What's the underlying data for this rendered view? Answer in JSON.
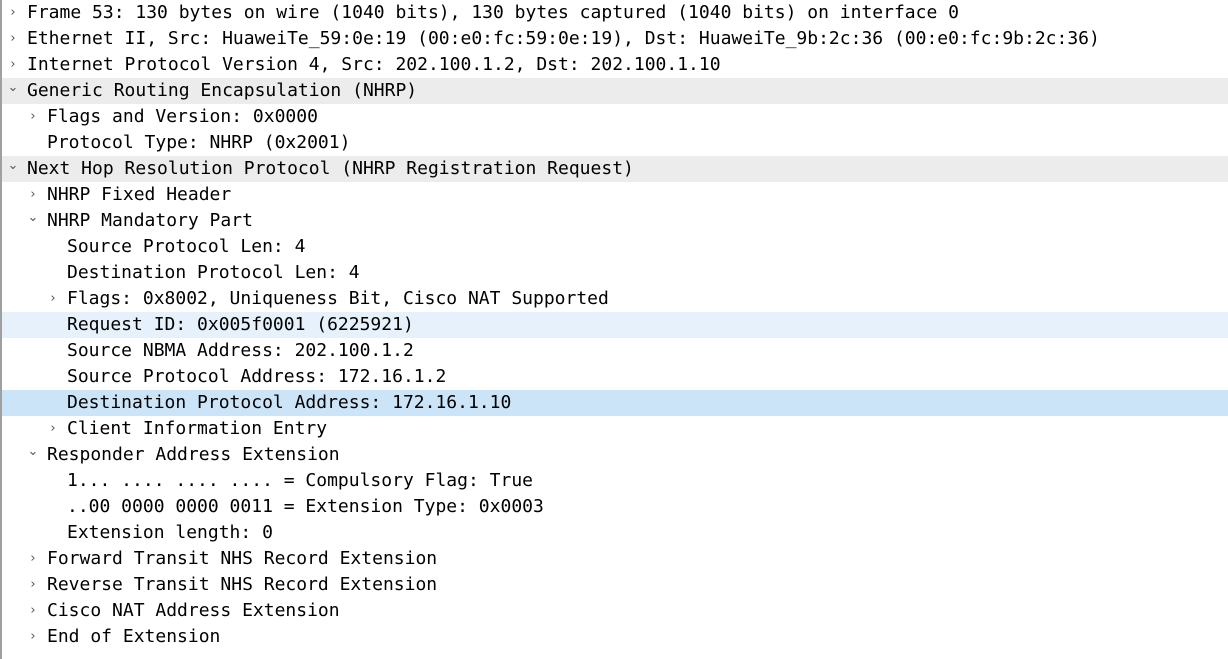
{
  "tree": {
    "rows": [
      {
        "text": "Frame 53: 130 bytes on wire (1040 bits), 130 bytes captured (1040 bits) on interface 0",
        "depth": 0,
        "expander": "collapsed",
        "state": "normal",
        "name": "frame"
      },
      {
        "text": "Ethernet II, Src: HuaweiTe_59:0e:19 (00:e0:fc:59:0e:19), Dst: HuaweiTe_9b:2c:36 (00:e0:fc:9b:2c:36)",
        "depth": 0,
        "expander": "collapsed",
        "state": "normal",
        "name": "ethernet"
      },
      {
        "text": "Internet Protocol Version 4, Src: 202.100.1.2, Dst: 202.100.1.10",
        "depth": 0,
        "expander": "collapsed",
        "state": "normal",
        "name": "ipv4"
      },
      {
        "text": "Generic Routing Encapsulation (NHRP)",
        "depth": 0,
        "expander": "expanded",
        "state": "gray",
        "name": "gre"
      },
      {
        "text": "Flags and Version: 0x0000",
        "depth": 1,
        "expander": "collapsed",
        "state": "normal",
        "name": "gre-flags-version"
      },
      {
        "text": "Protocol Type: NHRP (0x2001)",
        "depth": 1,
        "expander": "none",
        "state": "normal",
        "name": "gre-protocol-type"
      },
      {
        "text": "Next Hop Resolution Protocol (NHRP Registration Request)",
        "depth": 0,
        "expander": "expanded",
        "state": "gray",
        "name": "nhrp"
      },
      {
        "text": "NHRP Fixed Header",
        "depth": 1,
        "expander": "collapsed",
        "state": "normal",
        "name": "nhrp-fixed-header"
      },
      {
        "text": "NHRP Mandatory Part",
        "depth": 1,
        "expander": "expanded",
        "state": "normal",
        "name": "nhrp-mandatory-part"
      },
      {
        "text": "Source Protocol Len: 4",
        "depth": 2,
        "expander": "none",
        "state": "normal",
        "name": "source-protocol-len"
      },
      {
        "text": "Destination Protocol Len: 4",
        "depth": 2,
        "expander": "none",
        "state": "normal",
        "name": "destination-protocol-len"
      },
      {
        "text": "Flags: 0x8002, Uniqueness Bit, Cisco NAT Supported",
        "depth": 2,
        "expander": "collapsed",
        "state": "normal",
        "name": "nhrp-flags"
      },
      {
        "text": "Request ID: 0x005f0001 (6225921)",
        "depth": 2,
        "expander": "none",
        "state": "related",
        "name": "request-id"
      },
      {
        "text": "Source NBMA Address: 202.100.1.2",
        "depth": 2,
        "expander": "none",
        "state": "normal",
        "name": "source-nbma-address"
      },
      {
        "text": "Source Protocol Address: 172.16.1.2",
        "depth": 2,
        "expander": "none",
        "state": "normal",
        "name": "source-protocol-address"
      },
      {
        "text": "Destination Protocol Address: 172.16.1.10",
        "depth": 2,
        "expander": "none",
        "state": "selected",
        "name": "destination-protocol-address"
      },
      {
        "text": "Client Information Entry",
        "depth": 2,
        "expander": "collapsed",
        "state": "normal",
        "name": "client-information-entry"
      },
      {
        "text": "Responder Address Extension",
        "depth": 1,
        "expander": "expanded",
        "state": "normal",
        "name": "responder-address-extension"
      },
      {
        "text": "1... .... .... .... = Compulsory Flag: True",
        "depth": 2,
        "expander": "none",
        "state": "normal",
        "name": "compulsory-flag"
      },
      {
        "text": "..00 0000 0000 0011 = Extension Type: 0x0003",
        "depth": 2,
        "expander": "none",
        "state": "normal",
        "name": "extension-type"
      },
      {
        "text": "Extension length: 0",
        "depth": 2,
        "expander": "none",
        "state": "normal",
        "name": "extension-length"
      },
      {
        "text": "Forward Transit NHS Record Extension",
        "depth": 1,
        "expander": "collapsed",
        "state": "normal",
        "name": "forward-transit-nhs-record-extension"
      },
      {
        "text": "Reverse Transit NHS Record Extension",
        "depth": 1,
        "expander": "collapsed",
        "state": "normal",
        "name": "reverse-transit-nhs-record-extension"
      },
      {
        "text": "Cisco NAT Address Extension",
        "depth": 1,
        "expander": "collapsed",
        "state": "normal",
        "name": "cisco-nat-address-extension"
      },
      {
        "text": "End of Extension",
        "depth": 1,
        "expander": "collapsed",
        "state": "normal",
        "name": "end-of-extension"
      }
    ]
  },
  "icons": {
    "collapsed": "chevron-right-icon",
    "expanded": "chevron-down-icon"
  },
  "colors": {
    "top_level_background": "#ececec",
    "selected_background": "#cce4f7",
    "related_background": "#e7f1fb",
    "text": "#000000",
    "expander": "#555555"
  }
}
